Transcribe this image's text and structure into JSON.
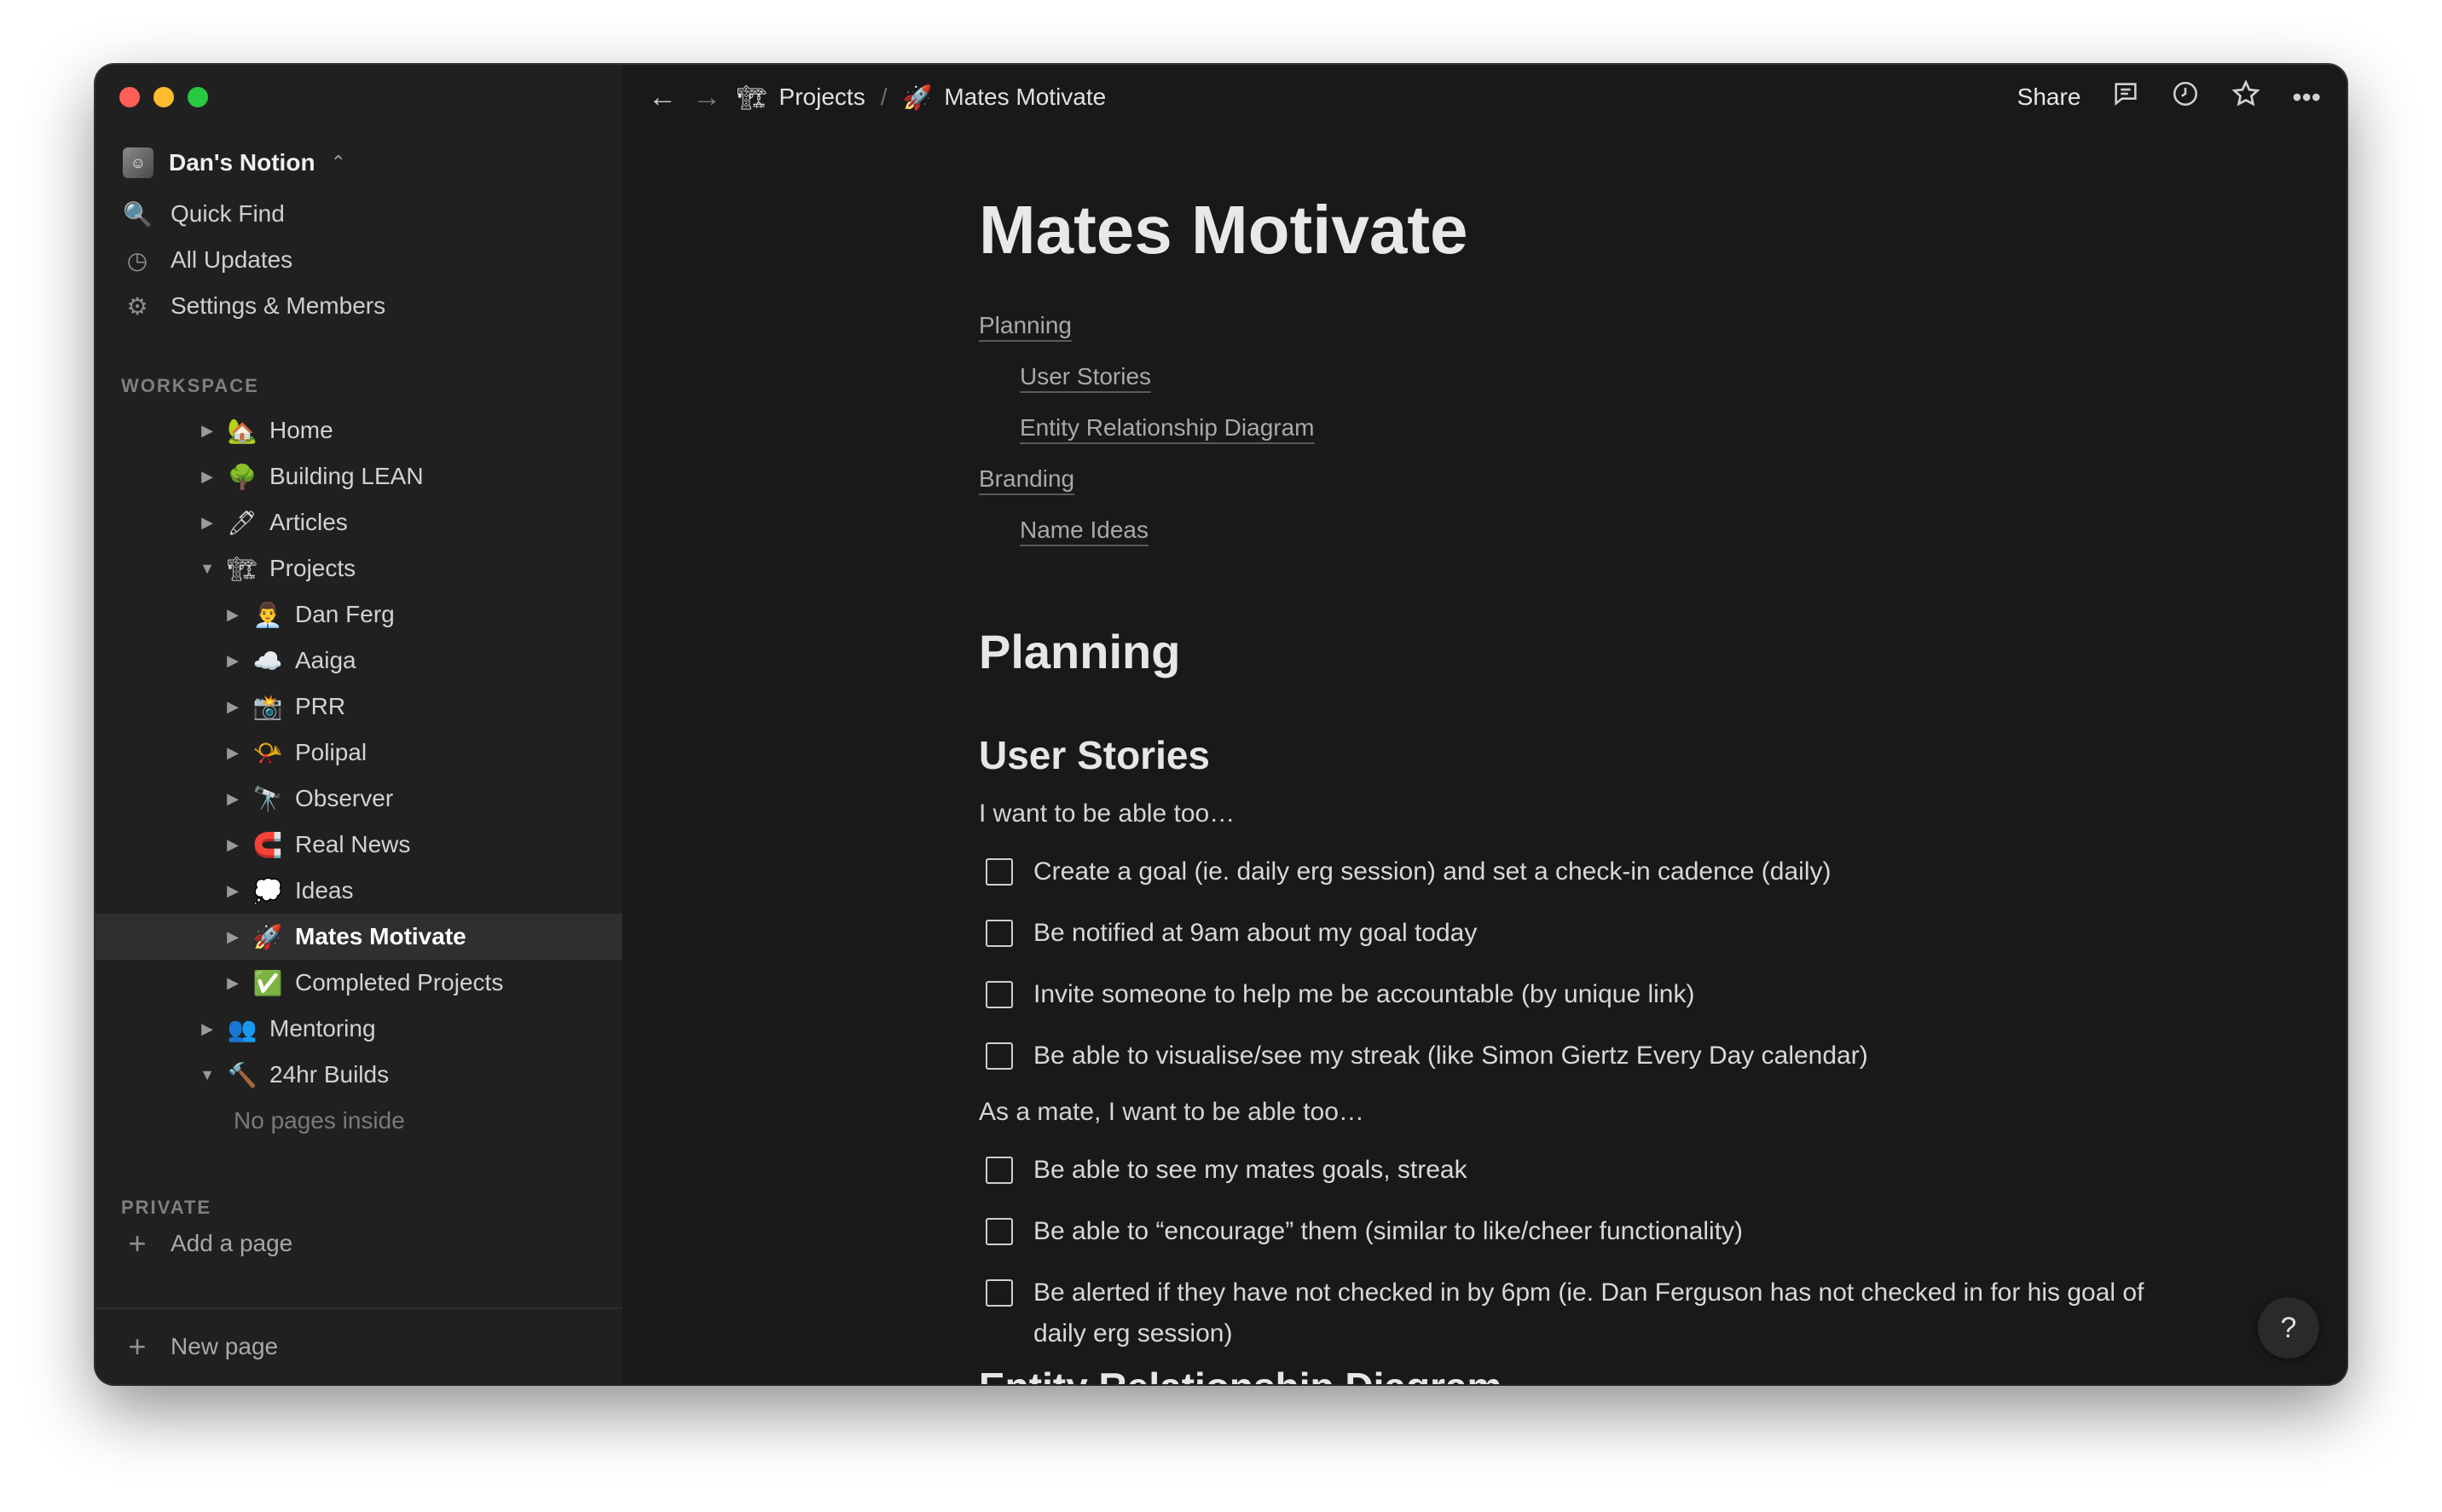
{
  "workspace": {
    "name": "Dan's Notion",
    "avatar_icon": "person-photo-icon"
  },
  "topnav": [
    {
      "label": "Quick Find",
      "icon": "🔍"
    },
    {
      "label": "All Updates",
      "icon": "◷"
    },
    {
      "label": "Settings & Members",
      "icon": "⚙"
    }
  ],
  "sections": {
    "workspace": "WORKSPACE",
    "private": "PRIVATE"
  },
  "tree": [
    {
      "label": "Home",
      "emoji": "🏡",
      "arrow": "▶",
      "indent": 0
    },
    {
      "label": "Building LEAN",
      "emoji": "🌳",
      "arrow": "▶",
      "indent": 0
    },
    {
      "label": "Articles",
      "emoji": "🖊",
      "arrow": "▶",
      "indent": 0
    },
    {
      "label": "Projects",
      "emoji": "🏗",
      "arrow": "▼",
      "indent": 0
    },
    {
      "label": "Dan Ferg",
      "emoji": "👨‍💼",
      "arrow": "▶",
      "indent": 1
    },
    {
      "label": "Aaiga",
      "emoji": "☁️",
      "arrow": "▶",
      "indent": 1
    },
    {
      "label": "PRR",
      "emoji": "📸",
      "arrow": "▶",
      "indent": 1
    },
    {
      "label": "Polipal",
      "emoji": "📯",
      "arrow": "▶",
      "indent": 1
    },
    {
      "label": "Observer",
      "emoji": "🔭",
      "arrow": "▶",
      "indent": 1
    },
    {
      "label": "Real News",
      "emoji": "🧲",
      "arrow": "▶",
      "indent": 1
    },
    {
      "label": "Ideas",
      "emoji": "💭",
      "arrow": "▶",
      "indent": 1
    },
    {
      "label": "Mates Motivate",
      "emoji": "🚀",
      "arrow": "▶",
      "indent": 1,
      "active": true
    },
    {
      "label": "Completed Projects",
      "emoji": "✅",
      "arrow": "▶",
      "indent": 1
    },
    {
      "label": "Mentoring",
      "emoji": "👥",
      "arrow": "▶",
      "indent": 0
    },
    {
      "label": "24hr Builds",
      "emoji": "🔨",
      "arrow": "▼",
      "indent": 0
    },
    {
      "label": "No pages inside",
      "emoji": "",
      "arrow": "",
      "indent": 1,
      "muted": true
    }
  ],
  "add_page": "Add a page",
  "new_page": "New page",
  "breadcrumb": {
    "back_icon": "←",
    "forward_icon": "→",
    "parent": {
      "emoji": "🏗",
      "label": "Projects"
    },
    "separator": "/",
    "current": {
      "emoji": "🚀",
      "label": "Mates Motivate"
    }
  },
  "actions": {
    "share": "Share",
    "comment_icon": "💬",
    "history_icon": "◷",
    "favorite_icon": "☆",
    "more_icon": "•••"
  },
  "page": {
    "title": "Mates Motivate",
    "toc": [
      {
        "label": "Planning",
        "sub": false
      },
      {
        "label": "User Stories",
        "sub": true
      },
      {
        "label": "Entity Relationship Diagram",
        "sub": true
      },
      {
        "label": "Branding",
        "sub": false
      },
      {
        "label": "Name Ideas",
        "sub": true
      }
    ],
    "h1": "Planning",
    "h2": "User Stories",
    "intro1": "I want to be able too…",
    "todos1": [
      "Create a goal (ie. daily erg session) and set a check-in cadence (daily)",
      "Be notified at 9am about my goal today",
      "Invite someone to help me be accountable (by unique link)",
      "Be able to visualise/see my streak (like Simon Giertz Every Day calendar)"
    ],
    "intro2": "As a mate, I want to be able too…",
    "todos2": [
      "Be able to see my mates goals, streak",
      "Be able to “encourage” them (similar to like/cheer functionality)",
      "Be alerted if they have not checked in by 6pm (ie. Dan Ferguson has not checked in for his goal of daily erg session)"
    ],
    "cutoff_heading": "Entity Relationship Diagram"
  },
  "help_label": "?"
}
